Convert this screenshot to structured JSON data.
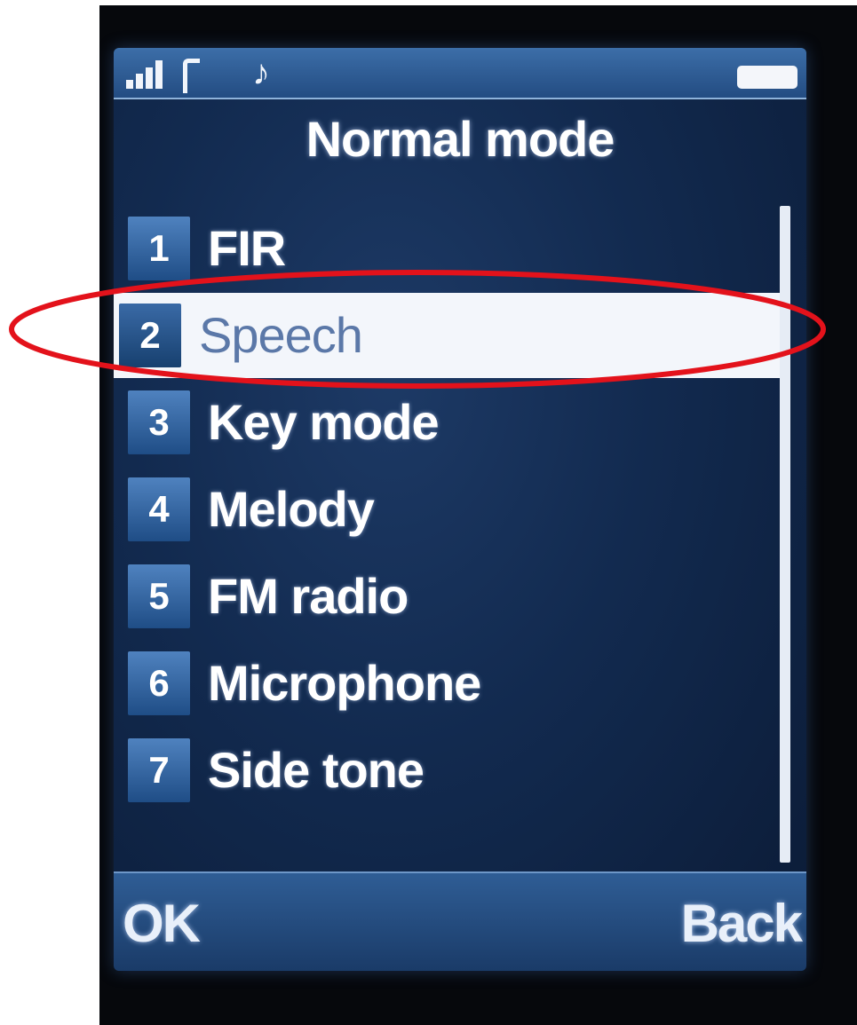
{
  "header": {
    "title": "Normal mode"
  },
  "status_bar": {
    "signal": "signal-icon",
    "antenna": "antenna-icon",
    "music": "music-icon",
    "battery": "battery-icon"
  },
  "menu": {
    "items": [
      {
        "number": "1",
        "label": "FIR"
      },
      {
        "number": "2",
        "label": "Speech"
      },
      {
        "number": "3",
        "label": "Key mode"
      },
      {
        "number": "4",
        "label": "Melody"
      },
      {
        "number": "5",
        "label": "FM radio"
      },
      {
        "number": "6",
        "label": "Microphone"
      },
      {
        "number": "7",
        "label": "Side tone"
      }
    ],
    "selected_index": 1
  },
  "softkeys": {
    "left": "OK",
    "right": "Back"
  },
  "colors": {
    "screen_bg": "#122a4f",
    "highlight_bg": "#f3f6fb",
    "annotation": "#e3121b"
  }
}
